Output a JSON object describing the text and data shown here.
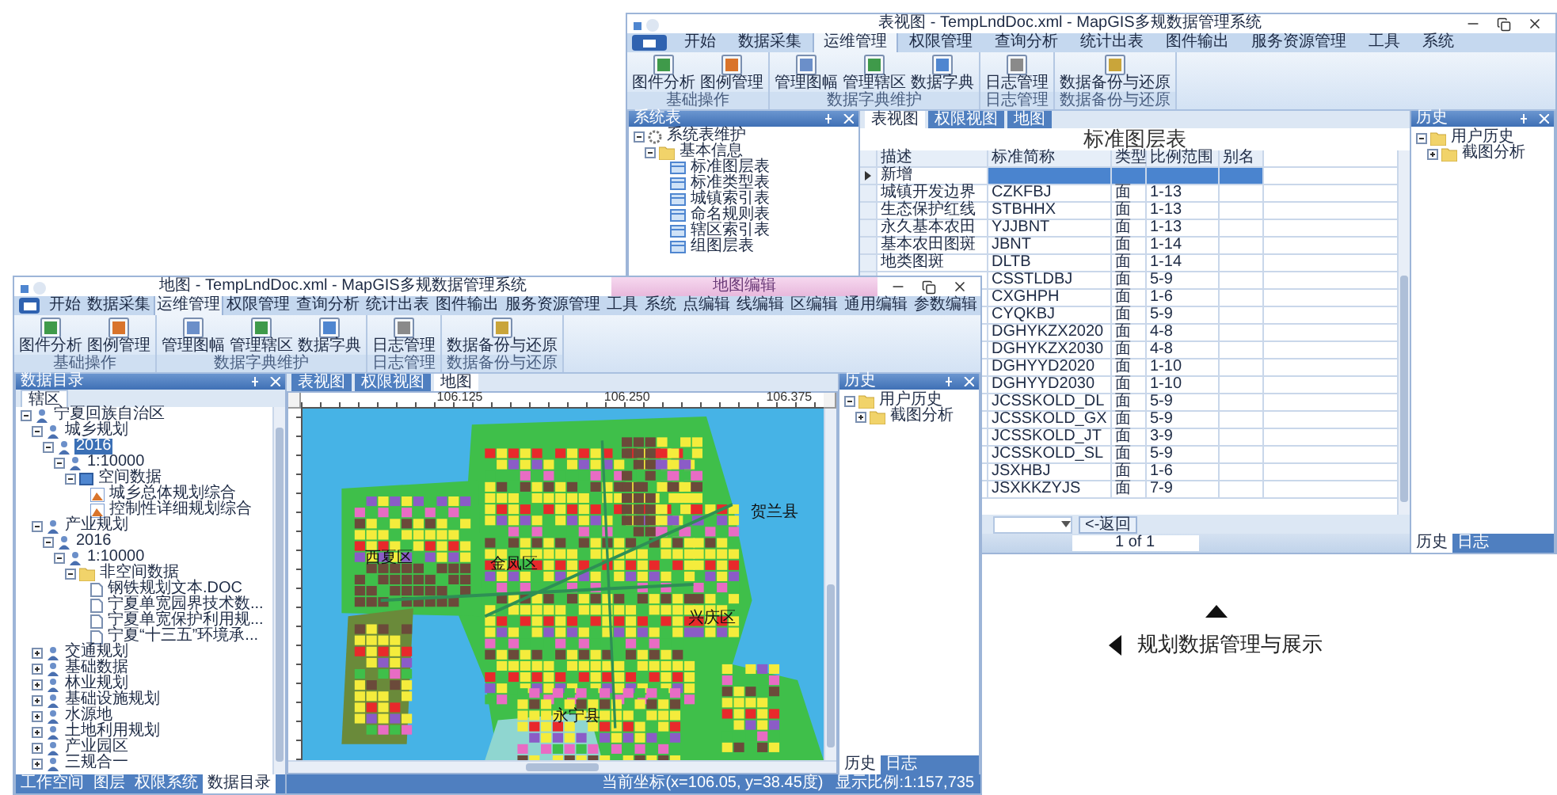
{
  "back_window": {
    "title": "表视图 - TempLndDoc.xml - MapGIS多规数据管理系统",
    "ribbon_tabs": [
      {
        "label": "开始",
        "selected": false
      },
      {
        "label": "数据采集",
        "selected": false
      },
      {
        "label": "运维管理",
        "selected": true
      },
      {
        "label": "权限管理",
        "selected": false
      },
      {
        "label": "查询分析",
        "selected": false
      },
      {
        "label": "统计出表",
        "selected": false
      },
      {
        "label": "图件输出",
        "selected": false
      },
      {
        "label": "服务资源管理",
        "selected": false
      },
      {
        "label": "工具",
        "selected": false
      },
      {
        "label": "系统",
        "selected": false
      }
    ],
    "ribbon_groups": [
      {
        "label": "基础操作",
        "buttons": [
          "图件分析",
          "图例管理"
        ]
      },
      {
        "label": "数据字典维护",
        "buttons": [
          "管理图幅",
          "管理辖区",
          "数据字典"
        ]
      },
      {
        "label": "日志管理",
        "buttons": [
          "日志管理"
        ]
      },
      {
        "label": "数据备份与还原",
        "buttons": [
          "数据备份与还原"
        ]
      }
    ],
    "left_panel": {
      "title": "系统表",
      "tree": [
        {
          "label": "系统表维护",
          "kind": "gear",
          "expanded": true,
          "selected": false,
          "children": [
            {
              "label": "基本信息",
              "kind": "folder",
              "expanded": true,
              "selected": false,
              "children": [
                {
                  "label": "标准图层表",
                  "kind": "table",
                  "selected": false
                },
                {
                  "label": "标准类型表",
                  "kind": "table",
                  "selected": false
                },
                {
                  "label": "城镇索引表",
                  "kind": "table",
                  "selected": false
                },
                {
                  "label": "命名规则表",
                  "kind": "table",
                  "selected": false
                },
                {
                  "label": "辖区索引表",
                  "kind": "table",
                  "selected": false
                },
                {
                  "label": "组图层表",
                  "kind": "table",
                  "selected": false
                }
              ]
            }
          ]
        }
      ]
    },
    "doc_tabs": [
      {
        "label": "表视图",
        "selected": true
      },
      {
        "label": "权限视图",
        "selected": false
      },
      {
        "label": "地图",
        "selected": false
      }
    ],
    "table": {
      "title": "标准图层表",
      "columns": [
        "描述",
        "标准简称",
        "类型",
        "比例范围",
        "别名"
      ],
      "rows": [
        {
          "desc": "新增",
          "selected": true
        },
        {
          "desc": "城镇开发边界",
          "code": "CZKFBJ",
          "type": "面",
          "scale": "1-13",
          "selected": false
        },
        {
          "desc": "生态保护红线",
          "code": "STBHHX",
          "type": "面",
          "scale": "1-13",
          "selected": false
        },
        {
          "desc": "永久基本农田",
          "code": "YJJBNT",
          "type": "面",
          "scale": "1-13",
          "selected": false
        },
        {
          "desc": "基本农田图斑",
          "code": "JBNT",
          "type": "面",
          "scale": "1-14",
          "selected": false
        },
        {
          "desc": "地类图斑",
          "code": "DLTB",
          "type": "面",
          "scale": "1-14",
          "selected": false
        },
        {
          "code": "CSSTLDBJ",
          "type": "面",
          "scale": "5-9",
          "selected": false
        },
        {
          "code": "CXGHPH",
          "type": "面",
          "scale": "1-6",
          "selected": false
        },
        {
          "code": "CYQKBJ",
          "type": "面",
          "scale": "5-9",
          "selected": false
        },
        {
          "code": "DGHYKZX2020",
          "type": "面",
          "scale": "4-8",
          "selected": false
        },
        {
          "code": "DGHYKZX2030",
          "type": "面",
          "scale": "4-8",
          "selected": false
        },
        {
          "code": "DGHYYD2020",
          "type": "面",
          "scale": "1-10",
          "selected": false
        },
        {
          "code": "DGHYYD2030",
          "type": "面",
          "scale": "1-10",
          "selected": false
        },
        {
          "code": "JCSSKOLD_DL",
          "type": "面",
          "scale": "5-9",
          "selected": false
        },
        {
          "code": "JCSSKOLD_GX",
          "type": "面",
          "scale": "5-9",
          "selected": false
        },
        {
          "code": "JCSSKOLD_JT",
          "type": "面",
          "scale": "3-9",
          "selected": false
        },
        {
          "code": "JCSSKOLD_SL",
          "type": "面",
          "scale": "5-9",
          "selected": false
        },
        {
          "code": "JSXHBJ",
          "type": "面",
          "scale": "1-6",
          "selected": false
        },
        {
          "code": "JSXKKZYJS",
          "type": "面",
          "scale": "7-9",
          "selected": false
        }
      ]
    },
    "pager": {
      "button": "<-返回",
      "page": "1 of 1"
    },
    "right_panel": {
      "title": "历史",
      "tree": [
        {
          "label": "用户历史",
          "kind": "folder",
          "expanded": true,
          "selected": false,
          "children": [
            {
              "label": "截图分析",
              "kind": "folder",
              "expanded": false,
              "selected": false
            }
          ]
        }
      ],
      "tabs": [
        {
          "label": "历史",
          "selected": true
        },
        {
          "label": "日志",
          "selected": false
        }
      ]
    }
  },
  "front_window": {
    "title": "地图 - TempLndDoc.xml - MapGIS多规数据管理系统",
    "context_group": "地图编辑",
    "ribbon_tabs": [
      {
        "label": "开始",
        "selected": false
      },
      {
        "label": "数据采集",
        "selected": false
      },
      {
        "label": "运维管理",
        "selected": true
      },
      {
        "label": "权限管理",
        "selected": false
      },
      {
        "label": "查询分析",
        "selected": false
      },
      {
        "label": "统计出表",
        "selected": false
      },
      {
        "label": "图件输出",
        "selected": false
      },
      {
        "label": "服务资源管理",
        "selected": false
      },
      {
        "label": "工具",
        "selected": false
      },
      {
        "label": "系统",
        "selected": false
      },
      {
        "label": "点编辑",
        "selected": false
      },
      {
        "label": "线编辑",
        "selected": false
      },
      {
        "label": "区编辑",
        "selected": false
      },
      {
        "label": "通用编辑",
        "selected": false
      },
      {
        "label": "参数编辑",
        "selected": false
      }
    ],
    "ribbon_groups": [
      {
        "label": "基础操作",
        "buttons": [
          "图件分析",
          "图例管理"
        ]
      },
      {
        "label": "数据字典维护",
        "buttons": [
          "管理图幅",
          "管理辖区",
          "数据字典"
        ]
      },
      {
        "label": "日志管理",
        "buttons": [
          "日志管理"
        ]
      },
      {
        "label": "数据备份与还原",
        "buttons": [
          "数据备份与还原"
        ]
      }
    ],
    "left_panel": {
      "title": "数据目录",
      "filter_tab": "辖区",
      "tree": [
        {
          "label": "宁夏回族自治区",
          "kind": "region",
          "expanded": true,
          "selected": false,
          "children": [
            {
              "label": "城乡规划",
              "kind": "region",
              "expanded": true,
              "selected": false,
              "children": [
                {
                  "label": "2016",
                  "kind": "region",
                  "expanded": true,
                  "selected": true,
                  "children": [
                    {
                      "label": "1:10000",
                      "kind": "region",
                      "expanded": true,
                      "selected": false,
                      "children": [
                        {
                          "label": "空间数据",
                          "kind": "layer",
                          "expanded": true,
                          "selected": false,
                          "children": [
                            {
                              "label": "城乡总体规划综合",
                              "kind": "map",
                              "selected": false
                            },
                            {
                              "label": "控制性详细规划综合",
                              "kind": "map",
                              "selected": false
                            }
                          ]
                        }
                      ]
                    }
                  ]
                }
              ]
            },
            {
              "label": "产业规划",
              "kind": "region",
              "expanded": true,
              "selected": false,
              "children": [
                {
                  "label": "2016",
                  "kind": "region",
                  "expanded": true,
                  "selected": false,
                  "children": [
                    {
                      "label": "1:10000",
                      "kind": "region",
                      "expanded": true,
                      "selected": false,
                      "children": [
                        {
                          "label": "非空间数据",
                          "kind": "folder",
                          "expanded": true,
                          "selected": false,
                          "children": [
                            {
                              "label": "钢铁规划文本.DOC",
                              "kind": "file",
                              "selected": false
                            },
                            {
                              "label": "宁夏单宽园界技术数...",
                              "kind": "file",
                              "selected": false
                            },
                            {
                              "label": "宁夏单宽保护利用规...",
                              "kind": "file",
                              "selected": false
                            },
                            {
                              "label": "宁夏“十三五”环境承...",
                              "kind": "file",
                              "selected": false
                            }
                          ]
                        }
                      ]
                    }
                  ]
                }
              ]
            },
            {
              "label": "交通规划",
              "kind": "region",
              "expanded": false,
              "selected": false
            },
            {
              "label": "基础数据",
              "kind": "region",
              "expanded": false,
              "selected": false
            },
            {
              "label": "林业规划",
              "kind": "region",
              "expanded": false,
              "selected": false
            },
            {
              "label": "基础设施规划",
              "kind": "region",
              "expanded": false,
              "selected": false
            },
            {
              "label": "水源地",
              "kind": "region",
              "expanded": false,
              "selected": false
            },
            {
              "label": "土地利用规划",
              "kind": "region",
              "expanded": false,
              "selected": false
            },
            {
              "label": "产业园区",
              "kind": "region",
              "expanded": false,
              "selected": false
            },
            {
              "label": "三规合一",
              "kind": "region",
              "expanded": false,
              "selected": false
            }
          ]
        }
      ],
      "tabs": [
        {
          "label": "工作空间",
          "selected": false
        },
        {
          "label": "图层",
          "selected": false
        },
        {
          "label": "权限系统",
          "selected": false
        },
        {
          "label": "数据目录",
          "selected": true
        }
      ]
    },
    "doc_tabs": [
      {
        "label": "表视图",
        "selected": false
      },
      {
        "label": "权限视图",
        "selected": false
      },
      {
        "label": "地图",
        "selected": true
      }
    ],
    "ruler_labels": [
      "106.125",
      "106.250",
      "106.375"
    ],
    "map_labels": [
      "西夏区",
      "金凤区",
      "贺兰县",
      "兴庆区",
      "永宁县"
    ],
    "right_panel": {
      "title": "历史",
      "tree": [
        {
          "label": "用户历史",
          "kind": "folder",
          "expanded": true,
          "selected": false,
          "children": [
            {
              "label": "截图分析",
              "kind": "folder",
              "expanded": false,
              "selected": false
            }
          ]
        }
      ],
      "tabs": [
        {
          "label": "历史",
          "selected": true
        },
        {
          "label": "日志",
          "selected": false
        }
      ]
    },
    "status_bar": [
      "当前坐标(x=106.05, y=38.45度)",
      "显示比例:1:157,735"
    ]
  },
  "caption": {
    "text": "规划数据管理与展示"
  }
}
